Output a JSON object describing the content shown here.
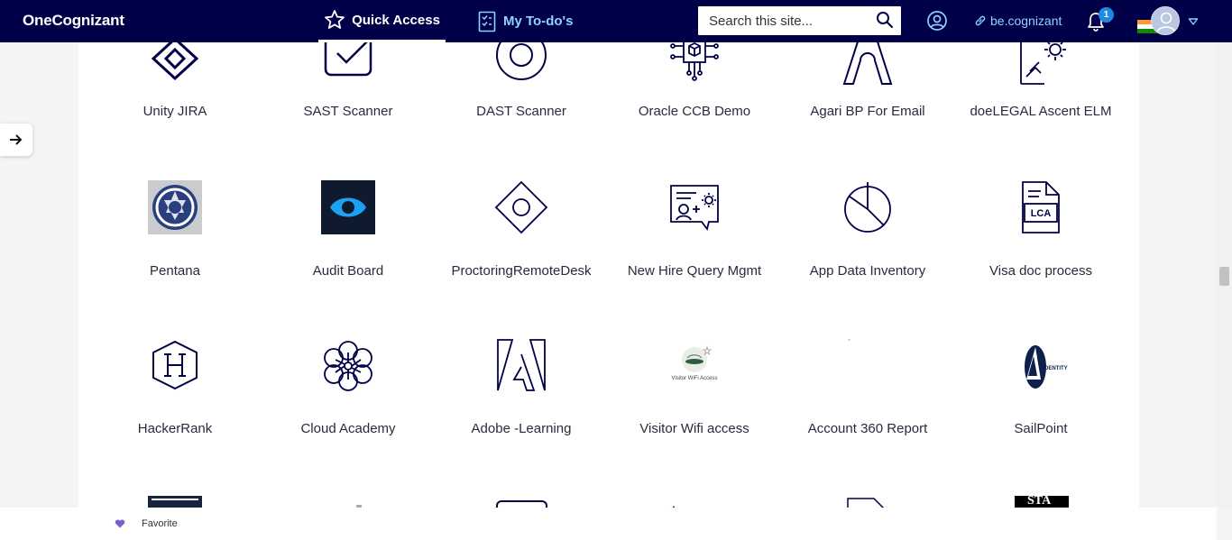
{
  "header": {
    "brand": "OneCognizant",
    "quick_access": "Quick Access",
    "my_todos": "My To-do's",
    "search_placeholder": "Search this site...",
    "be_link": "be.cognizant",
    "notification_count": "1"
  },
  "tiles": [
    {
      "label": "Unity JIRA",
      "icon": "diamond-icon"
    },
    {
      "label": "SAST Scanner",
      "icon": "checkbox-icon"
    },
    {
      "label": "DAST Scanner",
      "icon": "target-icon"
    },
    {
      "label": "Oracle CCB Demo",
      "icon": "circuit-cube-icon"
    },
    {
      "label": "Agari BP For Email",
      "icon": "arch-icon"
    },
    {
      "label": "doeLEGAL Ascent ELM",
      "icon": "legal-document-gear-icon"
    },
    {
      "label": "Pentana",
      "icon": "pentana-logo"
    },
    {
      "label": "Audit Board",
      "icon": "auditboard-logo"
    },
    {
      "label": "ProctoringRemoteDesk",
      "icon": "diamond-circle-icon"
    },
    {
      "label": "New Hire Query Mgmt",
      "icon": "new-hire-chat-icon"
    },
    {
      "label": "App Data Inventory",
      "icon": "pie-chart-icon"
    },
    {
      "label": "Visa doc process",
      "icon": "lca-document-icon"
    },
    {
      "label": "HackerRank",
      "icon": "hackerrank-logo"
    },
    {
      "label": "Cloud Academy",
      "icon": "cloud-academy-icon"
    },
    {
      "label": "Adobe -Learning",
      "icon": "adobe-logo"
    },
    {
      "label": "Visitor Wifi access",
      "icon": "visitor-wifi-logo"
    },
    {
      "label": "Account 360 Report",
      "icon": "account-360-icon"
    },
    {
      "label": "SailPoint",
      "icon": "sailpoint-logo"
    }
  ],
  "visitor_wifi_caption": "Visitor WiFi Access",
  "sailpoint_caption": "IDENTITY",
  "lca_text": "LCA",
  "sta_text": "STA",
  "footer": {
    "favorite": "Favorite"
  }
}
